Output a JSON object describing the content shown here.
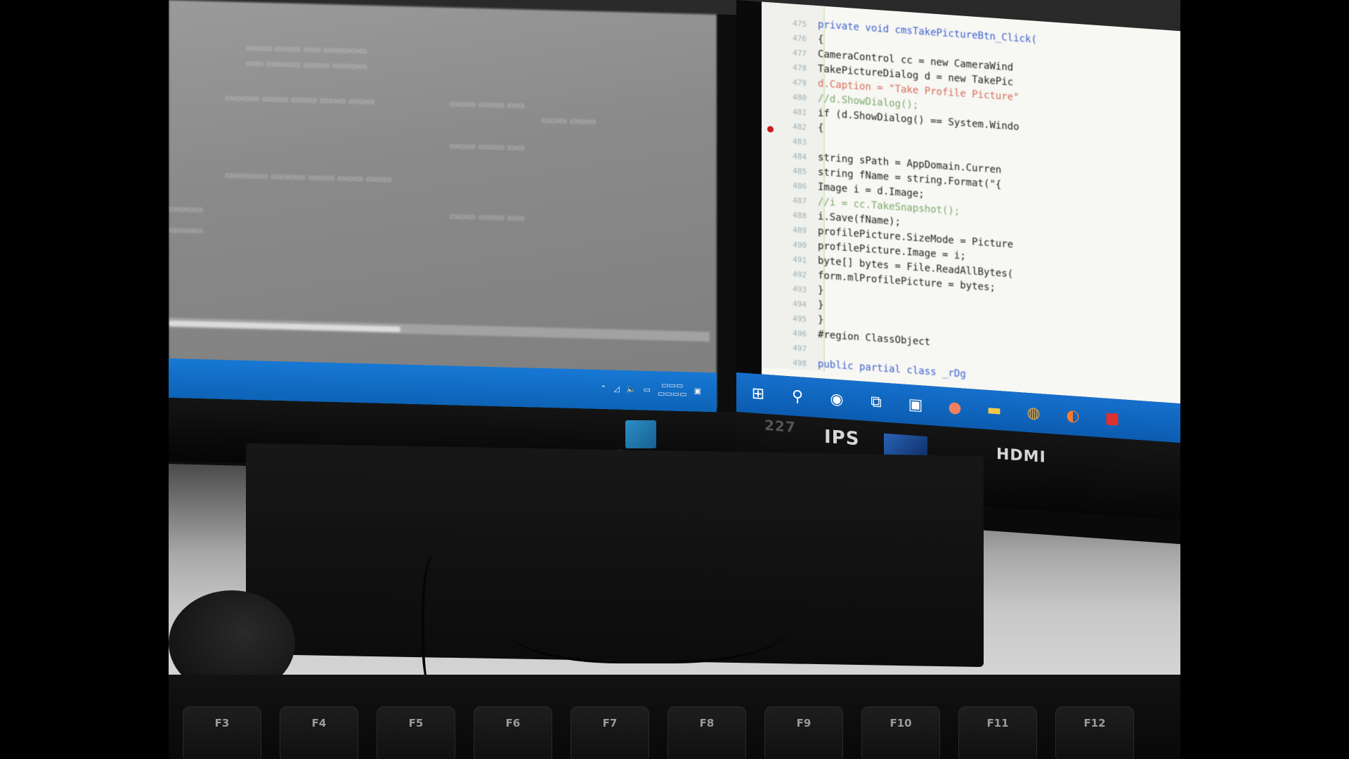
{
  "scene": {
    "description_colors": {
      "taskbar_blue": "#1670cc",
      "bezel_black": "#0a0a0a",
      "code_background": "#f7f7f3"
    }
  },
  "left_monitor": {
    "taskbar_icons": [
      "chevron-up-icon",
      "network-icon",
      "volume-icon",
      "language-icon",
      "notification-icon"
    ]
  },
  "right_monitor": {
    "code_lines": [
      {
        "ln": "475",
        "code": "private void cmsTakePictureBtn_Click(",
        "cls": "kw"
      },
      {
        "ln": "476",
        "code": "{",
        "cls": "txt"
      },
      {
        "ln": "477",
        "code": "    CameraControl cc = new CameraWind",
        "cls": "txt"
      },
      {
        "ln": "478",
        "code": "    TakePictureDialog d = new TakePic",
        "cls": "txt"
      },
      {
        "ln": "479",
        "code": "    d.Caption = \"Take Profile Picture\"",
        "cls": "str"
      },
      {
        "ln": "480",
        "code": "    //d.ShowDialog();",
        "cls": "cmt"
      },
      {
        "ln": "481",
        "code": "    if (d.ShowDialog() == System.Windo",
        "cls": "txt"
      },
      {
        "ln": "482",
        "code": "    {",
        "cls": "txt"
      },
      {
        "ln": "483",
        "code": "",
        "cls": "txt"
      },
      {
        "ln": "484",
        "code": "        string sPath = AppDomain.Curren",
        "cls": "txt"
      },
      {
        "ln": "485",
        "code": "        string fName = string.Format(\"{",
        "cls": "txt"
      },
      {
        "ln": "486",
        "code": "        Image i = d.Image;",
        "cls": "txt"
      },
      {
        "ln": "487",
        "code": "        //i = cc.TakeSnapshot();",
        "cls": "cmt"
      },
      {
        "ln": "488",
        "code": "        i.Save(fName);",
        "cls": "txt"
      },
      {
        "ln": "489",
        "code": "        profilePicture.SizeMode = Picture",
        "cls": "txt"
      },
      {
        "ln": "490",
        "code": "        profilePicture.Image = i;",
        "cls": "txt"
      },
      {
        "ln": "491",
        "code": "        byte[] bytes = File.ReadAllBytes(",
        "cls": "txt"
      },
      {
        "ln": "492",
        "code": "        form.mlProfilePicture = bytes;",
        "cls": "txt"
      },
      {
        "ln": "493",
        "code": "    }",
        "cls": "txt"
      },
      {
        "ln": "494",
        "code": "}",
        "cls": "txt"
      },
      {
        "ln": "495",
        "code": "}",
        "cls": "txt"
      },
      {
        "ln": "496",
        "code": "#region ClassObject",
        "cls": "txt"
      },
      {
        "ln": "497",
        "code": "",
        "cls": "txt"
      },
      {
        "ln": "498",
        "code": "public partial class _rDg",
        "cls": "kw"
      }
    ],
    "taskbar_icons": [
      "windows-start-icon",
      "search-icon",
      "cortana-icon",
      "task-view-icon",
      "store-icon",
      "paint-icon",
      "file-explorer-icon",
      "chrome-icon",
      "firefox-icon",
      "app-icon"
    ]
  },
  "bezel": {
    "model": "227",
    "ips": "IPS",
    "hdmi": "HDMI"
  },
  "keyboard": {
    "keys": [
      "F3",
      "F4",
      "F5",
      "F6",
      "F7",
      "F8",
      "F9",
      "F10",
      "F11",
      "F12"
    ]
  }
}
